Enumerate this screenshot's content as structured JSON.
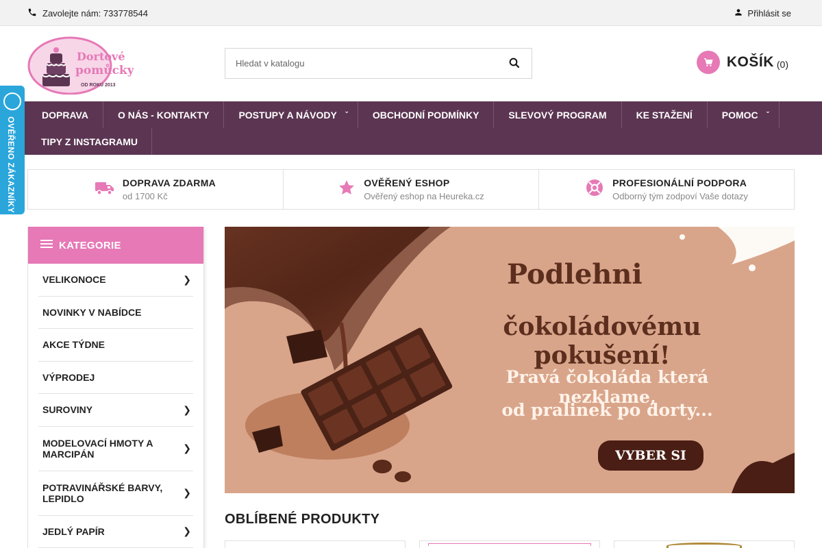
{
  "topbar": {
    "phone_text": "Zavolejte nám: 733778544",
    "login_text": "Přihlásit se"
  },
  "logo": {
    "line1": "Dortové",
    "line2": "pomůcky",
    "since": "OD ROKU 2013"
  },
  "search": {
    "placeholder": "Hledat v katalogu"
  },
  "cart": {
    "label": "KOŠÍK",
    "count": "(0)"
  },
  "nav": {
    "items": [
      {
        "label": "DOPRAVA",
        "has_sub": false
      },
      {
        "label": "O NÁS - KONTAKTY",
        "has_sub": false
      },
      {
        "label": "POSTUPY A NÁVODY",
        "has_sub": true
      },
      {
        "label": "OBCHODNÍ PODMÍNKY",
        "has_sub": false
      },
      {
        "label": "SLEVOVÝ PROGRAM",
        "has_sub": false
      },
      {
        "label": "KE STAŽENÍ",
        "has_sub": false
      },
      {
        "label": "POMOC",
        "has_sub": true
      },
      {
        "label": "TIPY Z INSTAGRAMU",
        "has_sub": false
      }
    ]
  },
  "features": [
    {
      "icon": "truck-icon",
      "title": "DOPRAVA ZDARMA",
      "subtitle": "od 1700 Kč"
    },
    {
      "icon": "star-icon",
      "title": "OVĚŘENÝ ESHOP",
      "subtitle": "Ověřený eshop na Heureka.cz"
    },
    {
      "icon": "lifebuoy-icon",
      "title": "PROFESIONÁLNÍ PODPORA",
      "subtitle": "Odborný tým zodpoví Vaše dotazy"
    }
  ],
  "sidebar": {
    "heading": "KATEGORIE",
    "items": [
      {
        "label": "VELIKONOCE",
        "has_sub": true
      },
      {
        "label": "NOVINKY V NABÍDCE",
        "has_sub": false
      },
      {
        "label": "AKCE TÝDNE",
        "has_sub": false
      },
      {
        "label": "VÝPRODEJ",
        "has_sub": false
      },
      {
        "label": "SUROVINY",
        "has_sub": true
      },
      {
        "label": "MODELOVACÍ HMOTY A MARCIPÁN",
        "has_sub": true
      },
      {
        "label": "POTRAVINÁŘSKÉ BARVY, LEPIDLO",
        "has_sub": true
      },
      {
        "label": "JEDLÝ PAPÍR",
        "has_sub": true
      }
    ]
  },
  "banner": {
    "line1": "Podlehni",
    "line2": "čokoládovému pokušení!",
    "line3": "Pravá čokoláda která nezklame,",
    "line4": "od pralinek po dorty...",
    "cta": "VYBER SI"
  },
  "favorites": {
    "title": "OBLÍBENÉ PRODUKTY"
  },
  "side_badge": {
    "text": "OVĚŘENO ZÁKAZNÍKY"
  },
  "colors": {
    "nav_bg": "#5b3552",
    "accent_pink": "#e679b6",
    "badge_blue": "#2aa6db"
  }
}
